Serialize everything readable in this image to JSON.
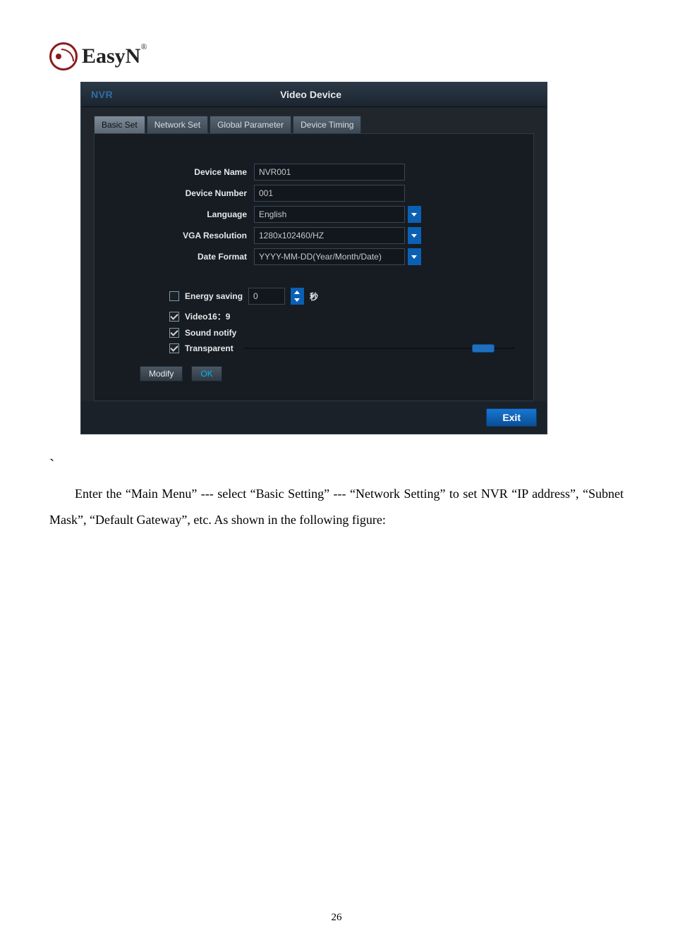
{
  "logo": {
    "brand": "EasyN"
  },
  "dialog": {
    "app": "NVR",
    "title": "Video Device",
    "tabs": [
      "Basic Set",
      "Network Set",
      "Global Parameter",
      "Device Timing"
    ],
    "form": {
      "device_name": {
        "label": "Device Name",
        "value": "NVR001"
      },
      "device_number": {
        "label": "Device Number",
        "value": "001"
      },
      "language": {
        "label": "Language",
        "value": "English"
      },
      "vga": {
        "label": "VGA Resolution",
        "value": "1280x102460/HZ"
      },
      "date_format": {
        "label": "Date Format",
        "value": "YYYY-MM-DD(Year/Month/Date)"
      }
    },
    "options": {
      "energy_saving": {
        "label": "Energy saving",
        "value": "0",
        "unit": "秒",
        "checked": false
      },
      "video169": {
        "label": "Video16：9",
        "checked": true
      },
      "sound_notify": {
        "label": "Sound notify",
        "checked": true
      },
      "transparent": {
        "label": "Transparent",
        "checked": true,
        "percent": 92
      }
    },
    "buttons": {
      "modify": "Modify",
      "ok": "OK",
      "exit": "Exit"
    }
  },
  "body_text": {
    "tick": "`",
    "paragraph": "Enter the “Main Menu” --- select “Basic Setting” --- “Network Setting” to set NVR “IP address”, “Subnet Mask”, “Default Gateway”, etc. As shown in the following figure:"
  },
  "page_number": "26"
}
